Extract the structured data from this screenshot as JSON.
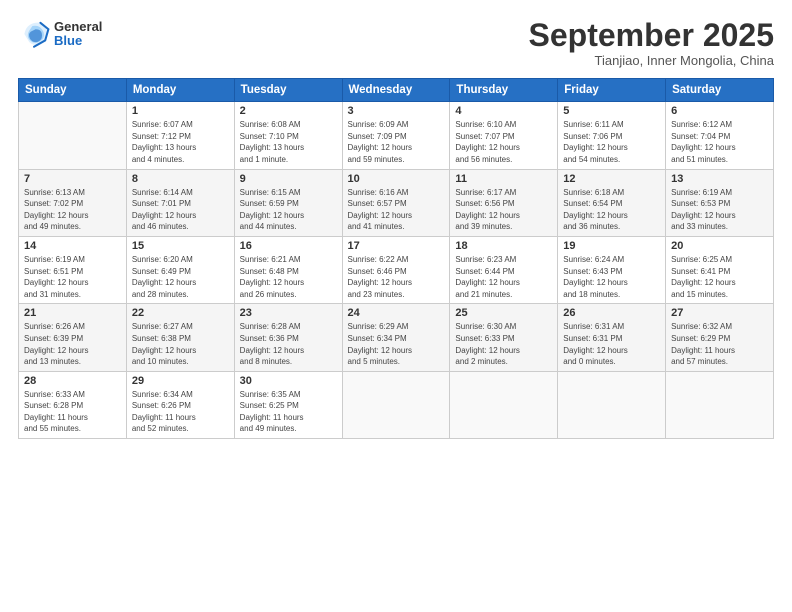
{
  "header": {
    "logo": {
      "general": "General",
      "blue": "Blue"
    },
    "title": "September 2025",
    "subtitle": "Tianjiao, Inner Mongolia, China"
  },
  "weekdays": [
    "Sunday",
    "Monday",
    "Tuesday",
    "Wednesday",
    "Thursday",
    "Friday",
    "Saturday"
  ],
  "weeks": [
    [
      {
        "day": "",
        "info": ""
      },
      {
        "day": "1",
        "info": "Sunrise: 6:07 AM\nSunset: 7:12 PM\nDaylight: 13 hours\nand 4 minutes."
      },
      {
        "day": "2",
        "info": "Sunrise: 6:08 AM\nSunset: 7:10 PM\nDaylight: 13 hours\nand 1 minute."
      },
      {
        "day": "3",
        "info": "Sunrise: 6:09 AM\nSunset: 7:09 PM\nDaylight: 12 hours\nand 59 minutes."
      },
      {
        "day": "4",
        "info": "Sunrise: 6:10 AM\nSunset: 7:07 PM\nDaylight: 12 hours\nand 56 minutes."
      },
      {
        "day": "5",
        "info": "Sunrise: 6:11 AM\nSunset: 7:06 PM\nDaylight: 12 hours\nand 54 minutes."
      },
      {
        "day": "6",
        "info": "Sunrise: 6:12 AM\nSunset: 7:04 PM\nDaylight: 12 hours\nand 51 minutes."
      }
    ],
    [
      {
        "day": "7",
        "info": "Sunrise: 6:13 AM\nSunset: 7:02 PM\nDaylight: 12 hours\nand 49 minutes."
      },
      {
        "day": "8",
        "info": "Sunrise: 6:14 AM\nSunset: 7:01 PM\nDaylight: 12 hours\nand 46 minutes."
      },
      {
        "day": "9",
        "info": "Sunrise: 6:15 AM\nSunset: 6:59 PM\nDaylight: 12 hours\nand 44 minutes."
      },
      {
        "day": "10",
        "info": "Sunrise: 6:16 AM\nSunset: 6:57 PM\nDaylight: 12 hours\nand 41 minutes."
      },
      {
        "day": "11",
        "info": "Sunrise: 6:17 AM\nSunset: 6:56 PM\nDaylight: 12 hours\nand 39 minutes."
      },
      {
        "day": "12",
        "info": "Sunrise: 6:18 AM\nSunset: 6:54 PM\nDaylight: 12 hours\nand 36 minutes."
      },
      {
        "day": "13",
        "info": "Sunrise: 6:19 AM\nSunset: 6:53 PM\nDaylight: 12 hours\nand 33 minutes."
      }
    ],
    [
      {
        "day": "14",
        "info": "Sunrise: 6:19 AM\nSunset: 6:51 PM\nDaylight: 12 hours\nand 31 minutes."
      },
      {
        "day": "15",
        "info": "Sunrise: 6:20 AM\nSunset: 6:49 PM\nDaylight: 12 hours\nand 28 minutes."
      },
      {
        "day": "16",
        "info": "Sunrise: 6:21 AM\nSunset: 6:48 PM\nDaylight: 12 hours\nand 26 minutes."
      },
      {
        "day": "17",
        "info": "Sunrise: 6:22 AM\nSunset: 6:46 PM\nDaylight: 12 hours\nand 23 minutes."
      },
      {
        "day": "18",
        "info": "Sunrise: 6:23 AM\nSunset: 6:44 PM\nDaylight: 12 hours\nand 21 minutes."
      },
      {
        "day": "19",
        "info": "Sunrise: 6:24 AM\nSunset: 6:43 PM\nDaylight: 12 hours\nand 18 minutes."
      },
      {
        "day": "20",
        "info": "Sunrise: 6:25 AM\nSunset: 6:41 PM\nDaylight: 12 hours\nand 15 minutes."
      }
    ],
    [
      {
        "day": "21",
        "info": "Sunrise: 6:26 AM\nSunset: 6:39 PM\nDaylight: 12 hours\nand 13 minutes."
      },
      {
        "day": "22",
        "info": "Sunrise: 6:27 AM\nSunset: 6:38 PM\nDaylight: 12 hours\nand 10 minutes."
      },
      {
        "day": "23",
        "info": "Sunrise: 6:28 AM\nSunset: 6:36 PM\nDaylight: 12 hours\nand 8 minutes."
      },
      {
        "day": "24",
        "info": "Sunrise: 6:29 AM\nSunset: 6:34 PM\nDaylight: 12 hours\nand 5 minutes."
      },
      {
        "day": "25",
        "info": "Sunrise: 6:30 AM\nSunset: 6:33 PM\nDaylight: 12 hours\nand 2 minutes."
      },
      {
        "day": "26",
        "info": "Sunrise: 6:31 AM\nSunset: 6:31 PM\nDaylight: 12 hours\nand 0 minutes."
      },
      {
        "day": "27",
        "info": "Sunrise: 6:32 AM\nSunset: 6:29 PM\nDaylight: 11 hours\nand 57 minutes."
      }
    ],
    [
      {
        "day": "28",
        "info": "Sunrise: 6:33 AM\nSunset: 6:28 PM\nDaylight: 11 hours\nand 55 minutes."
      },
      {
        "day": "29",
        "info": "Sunrise: 6:34 AM\nSunset: 6:26 PM\nDaylight: 11 hours\nand 52 minutes."
      },
      {
        "day": "30",
        "info": "Sunrise: 6:35 AM\nSunset: 6:25 PM\nDaylight: 11 hours\nand 49 minutes."
      },
      {
        "day": "",
        "info": ""
      },
      {
        "day": "",
        "info": ""
      },
      {
        "day": "",
        "info": ""
      },
      {
        "day": "",
        "info": ""
      }
    ]
  ]
}
